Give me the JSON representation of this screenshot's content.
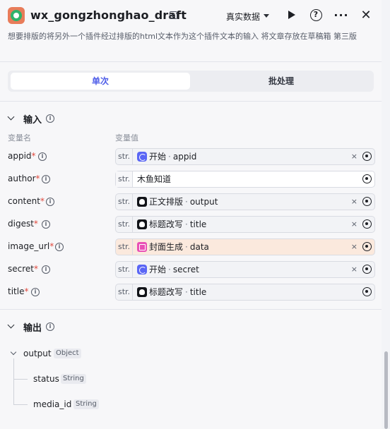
{
  "header": {
    "title": "wx_gongzhonghao_draft",
    "data_mode": "真实数据",
    "icons": [
      "app-icon",
      "edit-icon",
      "chevron-down-icon",
      "play-icon",
      "help-icon",
      "more-icon",
      "close-icon"
    ],
    "more_glyph": "···",
    "close_glyph": "✕",
    "help_glyph": "?"
  },
  "description": "想要排版的将另外一个插件经过排版的html文本作为这个插件文本的输入 将文章存放在草稿箱 第三版",
  "tabs": [
    {
      "label": "单次",
      "active": true
    },
    {
      "label": "批处理",
      "active": false
    }
  ],
  "input_section": {
    "title": "输入",
    "col_name": "变量名",
    "col_value": "变量值",
    "rows": [
      {
        "name": "appid",
        "required": true,
        "type": "str.",
        "source": "开始",
        "field": "appid",
        "kind": "start",
        "clearable": true
      },
      {
        "name": "author",
        "required": true,
        "type": "str.",
        "value": "木鱼知道",
        "kind": "text",
        "clearable": false
      },
      {
        "name": "content",
        "required": true,
        "type": "str.",
        "source": "正文排版",
        "field": "output",
        "kind": "bot",
        "clearable": true
      },
      {
        "name": "digest",
        "required": true,
        "type": "str.",
        "source": "标题改写",
        "field": "title",
        "kind": "bot",
        "clearable": true
      },
      {
        "name": "image_url",
        "required": true,
        "type": "str.",
        "source": "封面生成",
        "field": "data",
        "kind": "image",
        "clearable": true
      },
      {
        "name": "secret",
        "required": true,
        "type": "str.",
        "source": "开始",
        "field": "secret",
        "kind": "start",
        "clearable": true
      },
      {
        "name": "title",
        "required": true,
        "type": "str.",
        "source": "标题改写",
        "field": "title",
        "kind": "bot",
        "clearable": false
      }
    ],
    "required_mark": "*",
    "separator": "·",
    "clear_glyph": "×"
  },
  "output_section": {
    "title": "输出",
    "root": {
      "name": "output",
      "type": "Object"
    },
    "children": [
      {
        "name": "status",
        "type": "String"
      },
      {
        "name": "media_id",
        "type": "String"
      }
    ]
  },
  "colors": {
    "accent": "#4e5de8",
    "required": "#e0483c",
    "start_icon": "#5a66f5",
    "image_icon": "#e950b5",
    "image_field_bg": "#fbe9dd"
  }
}
